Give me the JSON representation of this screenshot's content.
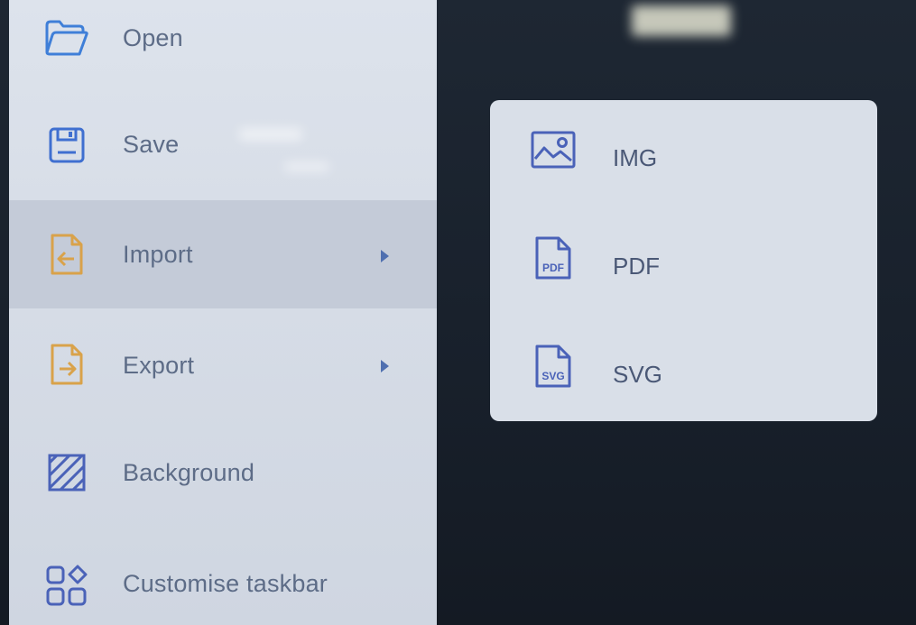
{
  "main_menu": {
    "items": [
      {
        "label": "Open",
        "icon": "folder-open-icon",
        "has_submenu": false
      },
      {
        "label": "Save",
        "icon": "floppy-disk-icon",
        "has_submenu": false
      },
      {
        "label": "Import",
        "icon": "file-import-icon",
        "has_submenu": true,
        "highlighted": true
      },
      {
        "label": "Export",
        "icon": "file-export-icon",
        "has_submenu": true
      },
      {
        "label": "Background",
        "icon": "hatched-square-icon",
        "has_submenu": false
      },
      {
        "label": "Customise taskbar",
        "icon": "grid-shapes-icon",
        "has_submenu": false
      }
    ]
  },
  "submenu": {
    "parent": "Import",
    "items": [
      {
        "label": "IMG",
        "icon": "image-icon"
      },
      {
        "label": "PDF",
        "icon": "pdf-file-icon",
        "icon_text": "PDF"
      },
      {
        "label": "SVG",
        "icon": "svg-file-icon",
        "icon_text": "SVG"
      }
    ]
  },
  "colors": {
    "menu_background": "#d7dde7",
    "highlight_background": "#c4cbd8",
    "label_text": "#5d6c87",
    "icon_blue": "#3f6fd0",
    "icon_orange": "#d9a24a",
    "arrow_blue": "#4f6fb0",
    "screen_dark": "#1b2330"
  }
}
